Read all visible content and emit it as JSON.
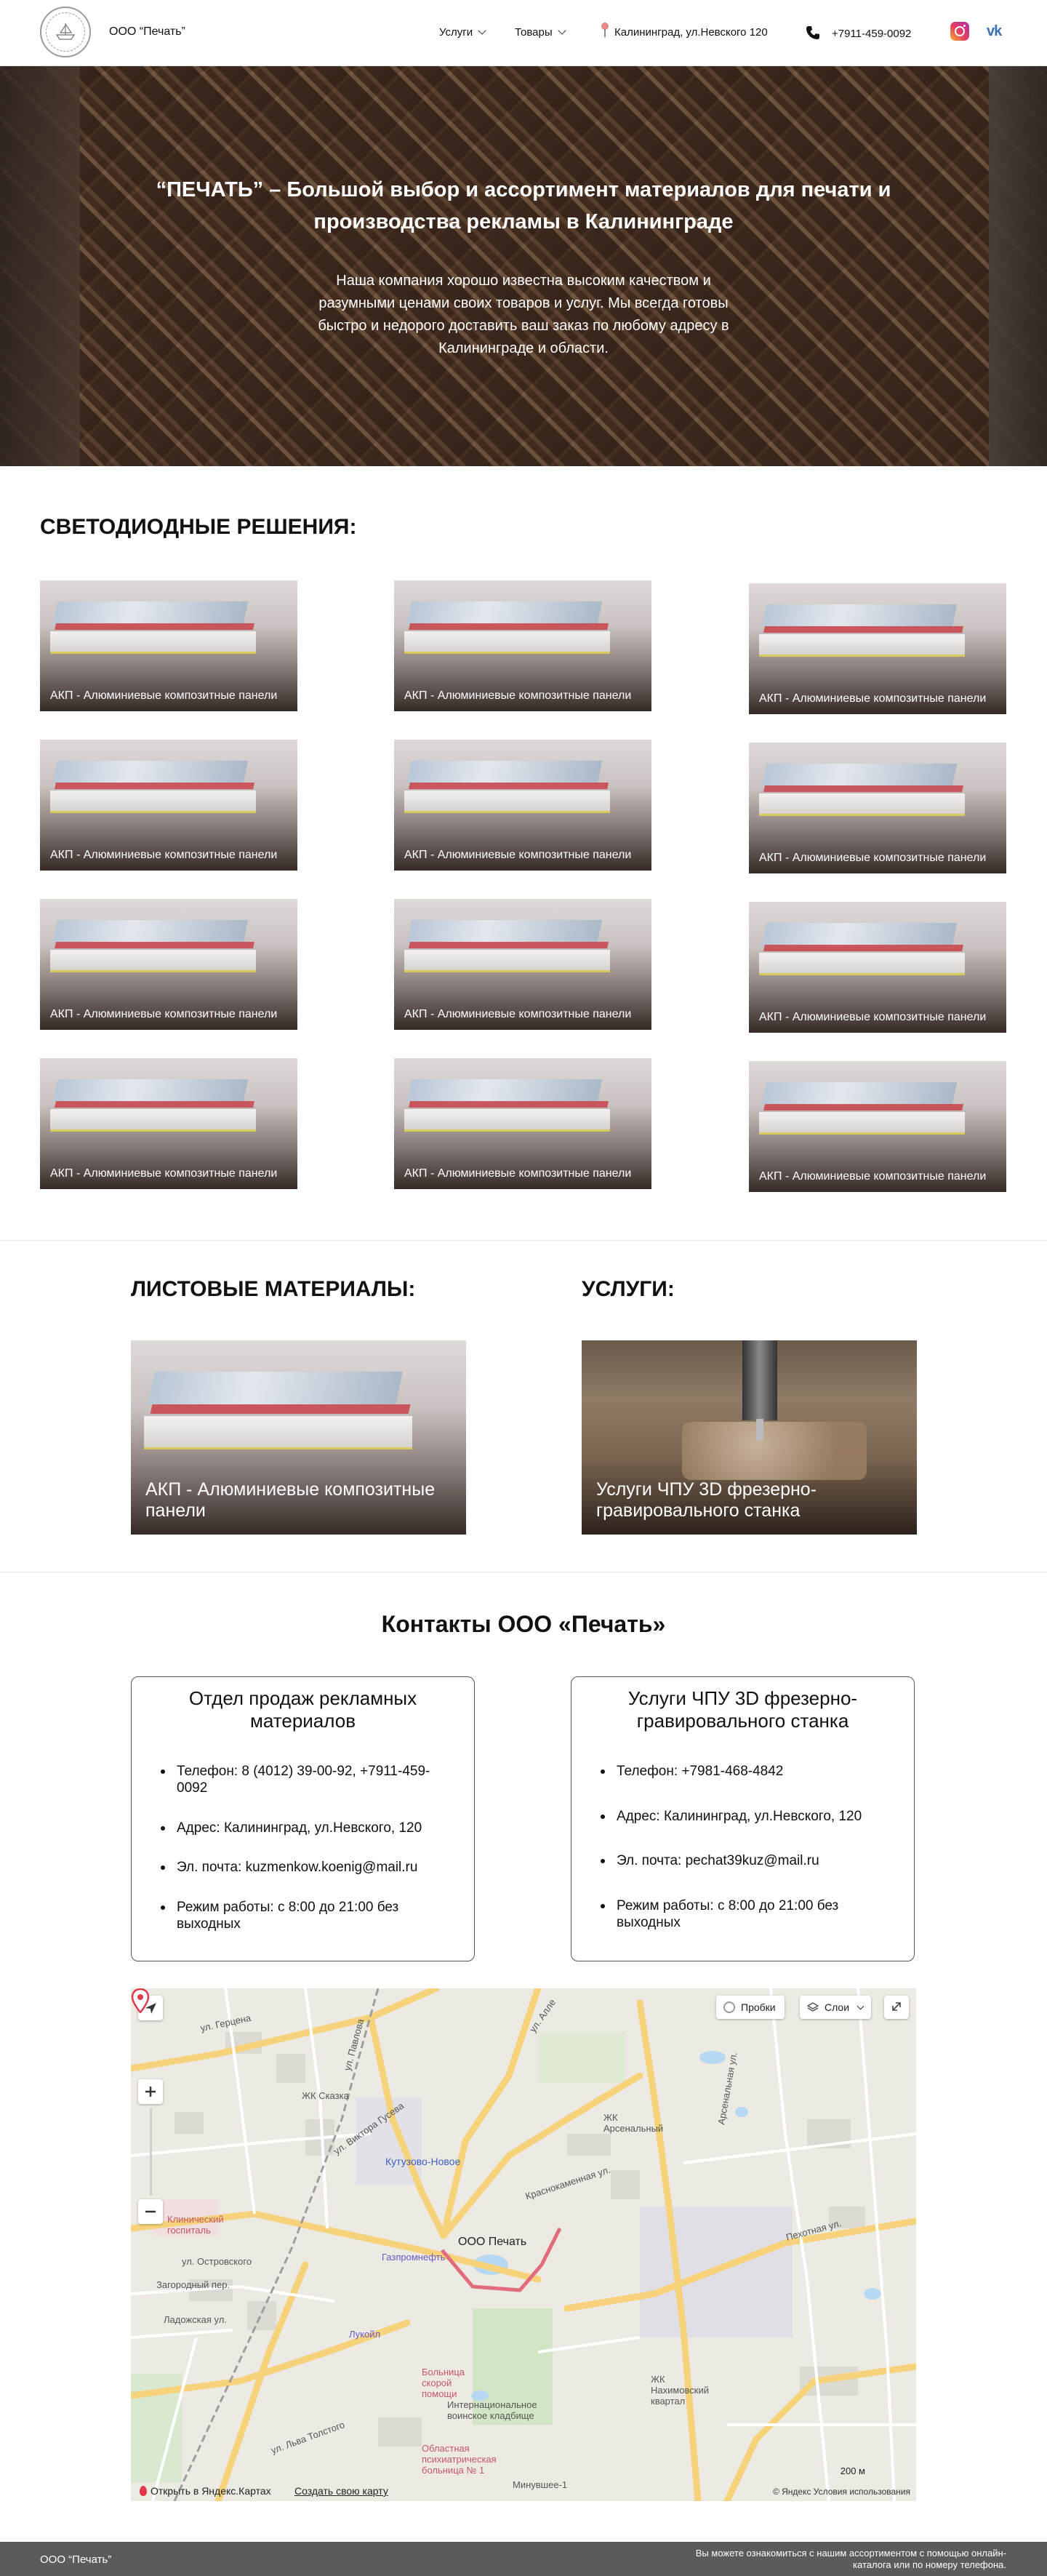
{
  "header": {
    "company": "ООО “Печать”",
    "nav": [
      {
        "label": "Услуги"
      },
      {
        "label": "Товары"
      }
    ],
    "address": "Калининград, ул.Невского 120",
    "phone": "+7911-459-0092",
    "social": [
      "instagram-icon",
      "vk-icon"
    ]
  },
  "hero": {
    "title": "“ПЕЧАТЬ” – Большой выбор и ассортимент материалов для печати и производства рекламы в Калининграде",
    "text": "Наша компания хорошо известна высоким качеством и разумными ценами своих товаров и услуг. Мы всегда готовы быстро и недорого доставить ваш заказ по любому адресу в Калининграде и области."
  },
  "led": {
    "title": "СВЕТОДИОДНЫЕ РЕШЕНИЯ:",
    "items": [
      {
        "label": "АКП - Алюминиевые композитные панели"
      },
      {
        "label": "АКП - Алюминиевые композитные панели"
      },
      {
        "label": "АКП - Алюминиевые композитные панели"
      },
      {
        "label": "АКП - Алюминиевые композитные панели"
      },
      {
        "label": "АКП - Алюминиевые композитные панели"
      },
      {
        "label": "АКП - Алюминиевые композитные панели"
      },
      {
        "label": "АКП - Алюминиевые композитные панели"
      },
      {
        "label": "АКП - Алюминиевые композитные панели"
      },
      {
        "label": "АКП - Алюминиевые композитные панели"
      },
      {
        "label": "АКП - Алюминиевые композитные панели"
      },
      {
        "label": "АКП - Алюминиевые композитные панели"
      },
      {
        "label": "АКП - Алюминиевые композитные панели"
      }
    ]
  },
  "sheets": {
    "title": "ЛИСТОВЫЕ МАТЕРИАЛЫ:",
    "card": "АКП - Алюминиевые композитные панели"
  },
  "services": {
    "title": "УСЛУГИ:",
    "card": "Услуги ЧПУ 3D фрезерно-гравировального станка"
  },
  "contacts": {
    "title": "Контакты ООО «Печать»",
    "boxes": [
      {
        "title": "Отдел продаж рекламных материалов",
        "phone": "Телефон:  8 (4012) 39-00-92, +7911-459-0092",
        "address": "Адрес: Калининград, ул.Невского, 120",
        "email": "Эл. почта:  kuzmenkow.koenig@mail.ru",
        "hours": "Режим работы: с 8:00 до 21:00 без выходных"
      },
      {
        "title": "Услуги ЧПУ 3D фрезерно-гравировального станка",
        "phone": "Телефон:  +7981-468-4842",
        "address": "Адрес: Калининград, ул.Невского, 120",
        "email": "Эл. почта: pechat39kuz@mail.ru",
        "hours": "Режим работы: с 8:00 до 21:00 без выходных"
      }
    ]
  },
  "map": {
    "traffic": "Пробки",
    "layers": "Слои",
    "marker": "ООО Печать",
    "open": "Открыть в Яндекс.Картах",
    "create": "Создать свою карту",
    "copyright": "© Яндекс Условия использования",
    "scale": "200 м",
    "streets": {
      "s1": "ул. Герцена",
      "s2": "ул. Алле",
      "s3": "ЖК Сказка",
      "s4": "Кутузово-Новое",
      "s5": "Клинический госпиталь",
      "s6": "ул. Островского",
      "s7": "Газпромнефть",
      "s8": "Лукойл",
      "s9": "Больница скорой помощи",
      "s10": "Интернациональное воинское кладбище",
      "s11": "Областная психиатрическая больница № 1",
      "s12": "Краснокаменная ул.",
      "s13": "Пехотная ул.",
      "s14": "ЖК Нахимовский квартал",
      "s15": "Арсенальная ул.",
      "s16": "ЖК Арсенальный",
      "s17": "Загородный пер.",
      "s18": "ул. Льва Толстого",
      "s19": "ул. Павлова",
      "s20": "Ладожская ул.",
      "s21": "Минувшее-1",
      "s22": "ул. Виктора Гусева"
    }
  },
  "footer": {
    "name": "ООО “Печать”",
    "note": "Вы можете ознакомиться с нашим ассортиментом с помощью онлайн-каталога или по номеру телефона."
  }
}
